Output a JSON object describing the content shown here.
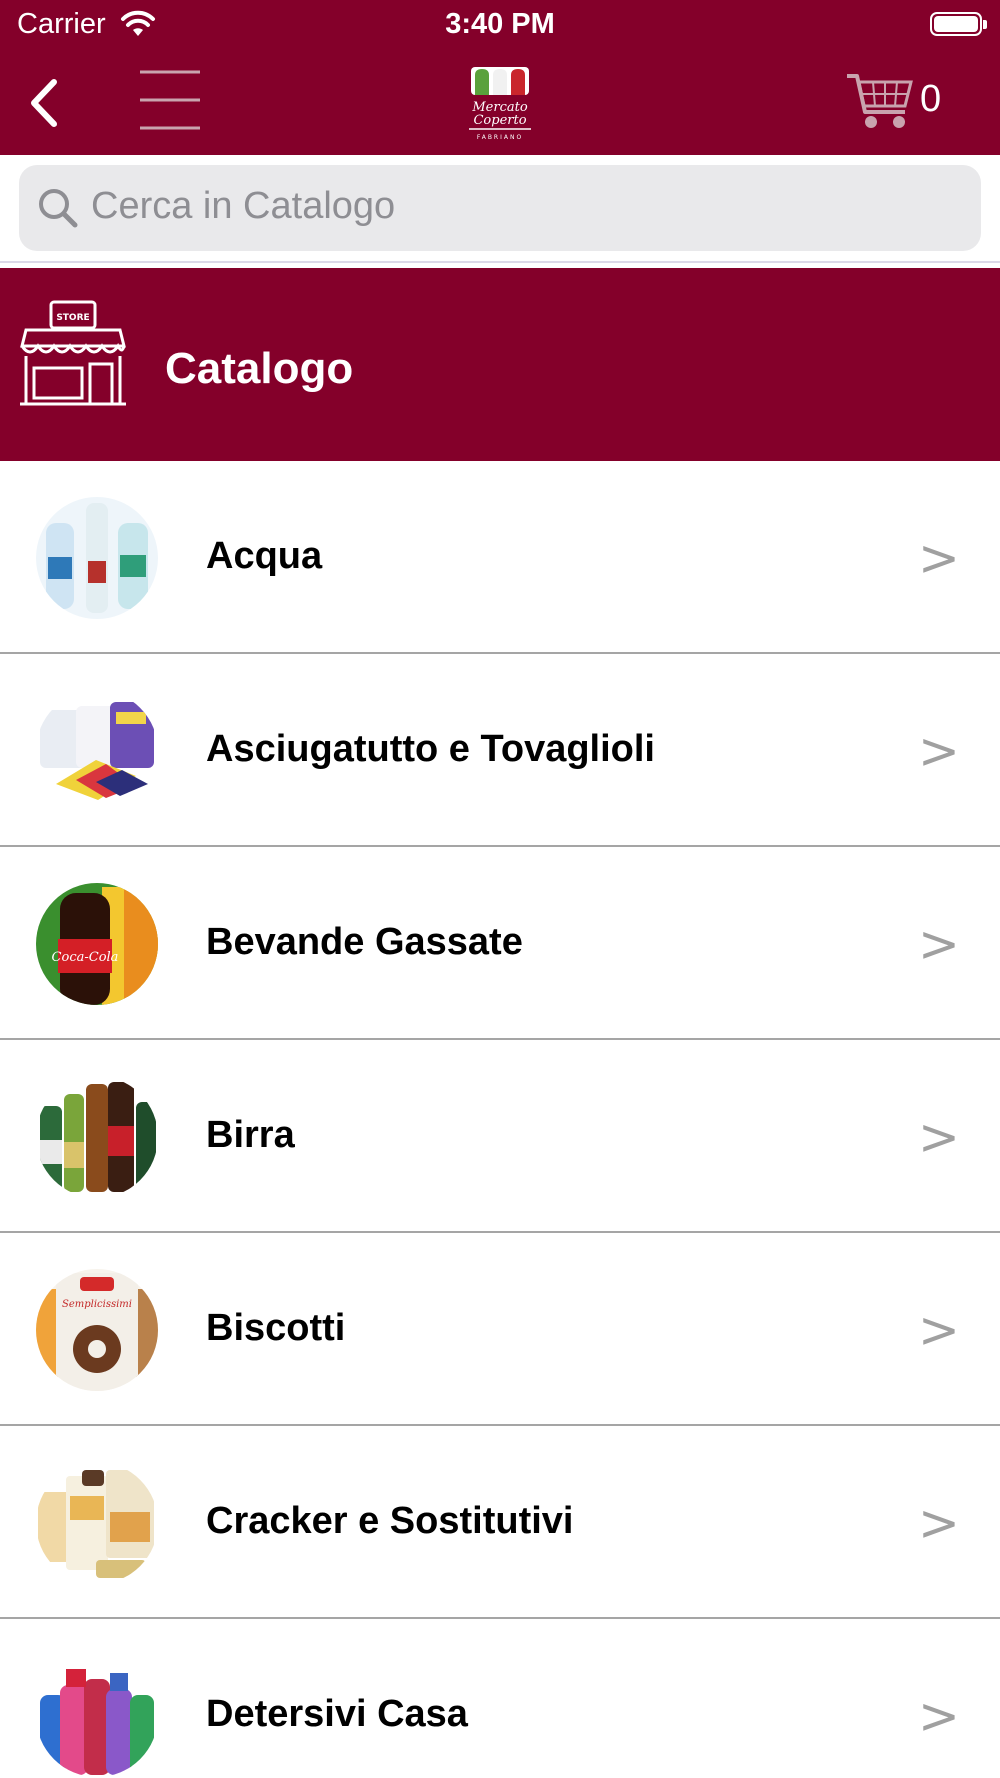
{
  "status_bar": {
    "carrier": "Carrier",
    "time": "3:40 PM"
  },
  "nav": {
    "cart_count": "0",
    "logo_text": "Mercato Coperto Fabriano"
  },
  "search": {
    "placeholder": "Cerca in Catalogo"
  },
  "section": {
    "title": "Catalogo",
    "store_sign": "STORE"
  },
  "categories": [
    {
      "label": "Acqua",
      "chevron": ">"
    },
    {
      "label": "Asciugatutto e Tovaglioli",
      "chevron": ">"
    },
    {
      "label": "Bevande Gassate",
      "chevron": ">"
    },
    {
      "label": "Birra",
      "chevron": ">"
    },
    {
      "label": "Biscotti",
      "chevron": ">"
    },
    {
      "label": "Cracker e Sostitutivi",
      "chevron": ">"
    },
    {
      "label": "Detersivi Casa",
      "chevron": ">"
    }
  ],
  "colors": {
    "brand": "#84002a",
    "chevron": "#a0a0a0",
    "search_bg": "#e9e9eb"
  }
}
